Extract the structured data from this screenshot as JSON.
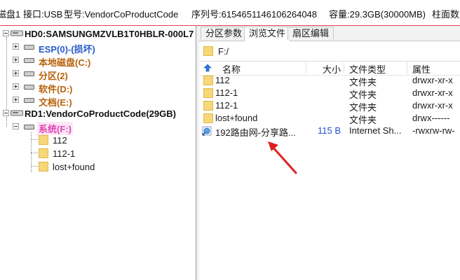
{
  "infobar": {
    "disk": "磁盘1",
    "interface": "接口:USB",
    "model": "型号:VendorCoProductCode",
    "serial": "序列号:6154651146106264048",
    "capacity": "容量:29.3GB(30000MB)",
    "cyl": "柱面数"
  },
  "tree": {
    "hd0": {
      "label": "HD0:SAMSUNGMZVLB1T0HBLR-000L7"
    },
    "hd0_parts": [
      {
        "label": "ESP(0)-(损坏)"
      },
      {
        "label": "本地磁盘(C:)"
      },
      {
        "label": "分区(2)"
      },
      {
        "label": "软件(D:)"
      },
      {
        "label": "文档(E:)"
      }
    ],
    "rd1": {
      "label": "RD1:VendorCoProductCode(29GB)"
    },
    "rd1_part": {
      "label": "系统(F:)"
    },
    "rd1_folders": [
      {
        "label": "112"
      },
      {
        "label": "112-1"
      },
      {
        "label": "lost+found"
      }
    ]
  },
  "tabs": [
    {
      "label": "分区参数"
    },
    {
      "label": "浏览文件"
    },
    {
      "label": "扇区编辑"
    }
  ],
  "path": "F:/",
  "columns": {
    "name": "名称",
    "size": "大小",
    "type": "文件类型",
    "attr": "属性"
  },
  "files": [
    {
      "name": "112",
      "size": "",
      "type": "文件夹",
      "attr": "drwxr-xr-x"
    },
    {
      "name": "112-1",
      "size": "",
      "type": "文件夹",
      "attr": "drwxr-xr-x"
    },
    {
      "name": "112-1",
      "size": "",
      "type": "文件夹",
      "attr": "drwxr-xr-x"
    },
    {
      "name": "lost+found",
      "size": "",
      "type": "文件夹",
      "attr": "drwx------"
    },
    {
      "name": "192路由网-分享路...",
      "size": "115 B",
      "type": "Internet Sh...",
      "attr": "-rwxrw-rw-"
    }
  ],
  "colors": {
    "accent_border": "#e0405a",
    "selected_partition": "#e046b2",
    "partition_text": "#b8620c",
    "esp_text": "#2a5bc9",
    "arrow": "#e02020",
    "folder": "#f6d77a"
  }
}
